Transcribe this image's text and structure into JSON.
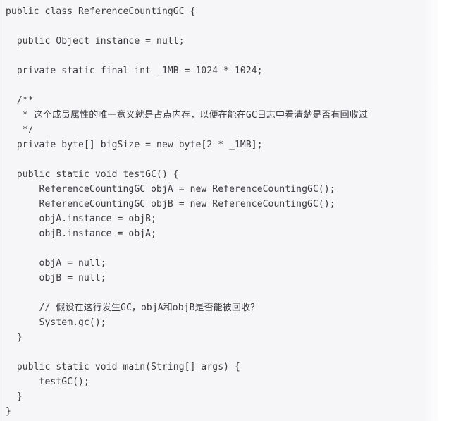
{
  "editor": {
    "language": "java",
    "class_name": "ReferenceCountingGC",
    "background_color": "#f6f6f9",
    "page_color": "#ffffff",
    "text_color": "#3b3b3f",
    "gutter_rule_color": "#ededf2"
  },
  "code": {
    "lines": [
      "public class ReferenceCountingGC {",
      "",
      "  public Object instance = null;",
      "",
      "  private static final int _1MB = 1024 * 1024;",
      "",
      "  /**",
      "   * 这个成员属性的唯一意义就是占点内存，以便在能在GC日志中看清楚是否有回收过",
      "   */",
      "  private byte[] bigSize = new byte[2 * _1MB];",
      "",
      "  public static void testGC() {",
      "      ReferenceCountingGC objA = new ReferenceCountingGC();",
      "      ReferenceCountingGC objB = new ReferenceCountingGC();",
      "      objA.instance = objB;",
      "      objB.instance = objA;",
      "",
      "      objA = null;",
      "      objB = null;",
      "",
      "      // 假设在这行发生GC，objA和objB是否能被回收？",
      "      System.gc();",
      "  }",
      "",
      "  public static void main(String[] args) {",
      "      testGC();",
      "  }",
      "}"
    ]
  }
}
